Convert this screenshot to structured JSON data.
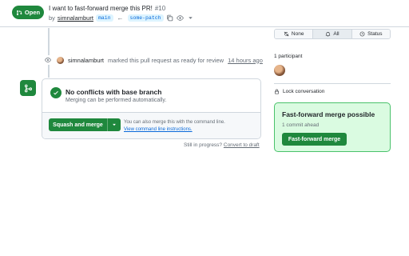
{
  "header": {
    "state_label": "Open",
    "title": "I want to fast-forward merge this PR!",
    "number": "#10",
    "by_label": "by",
    "author": "simnalamburt",
    "base_branch": "main",
    "head_branch": "some-patch"
  },
  "notifications": {
    "none_label": "None",
    "all_label": "All",
    "status_label": "Status"
  },
  "timeline": {
    "event_actor": "simnalamburt",
    "event_text": "marked this pull request as ready for review",
    "event_time": "14 hours ago"
  },
  "merge_box": {
    "status_title": "No conflicts with base branch",
    "status_subtitle": "Merging can be performed automatically.",
    "squash_label": "Squash and merge",
    "cli_text": "You can also merge this with the command line.",
    "cli_link": "View command line instructions.",
    "draft_prompt": "Still in progress?",
    "draft_link": "Convert to draft"
  },
  "sidebar": {
    "participants_label": "1 participant",
    "lock_label": "Lock conversation",
    "ff_title": "Fast-forward merge possible",
    "ff_subtitle": "1 commit ahead",
    "ff_button": "Fast-forward merge"
  },
  "colors": {
    "primary_green": "#1f883d",
    "ff_panel_bg": "#dafbe1",
    "link_blue": "#0969da"
  }
}
